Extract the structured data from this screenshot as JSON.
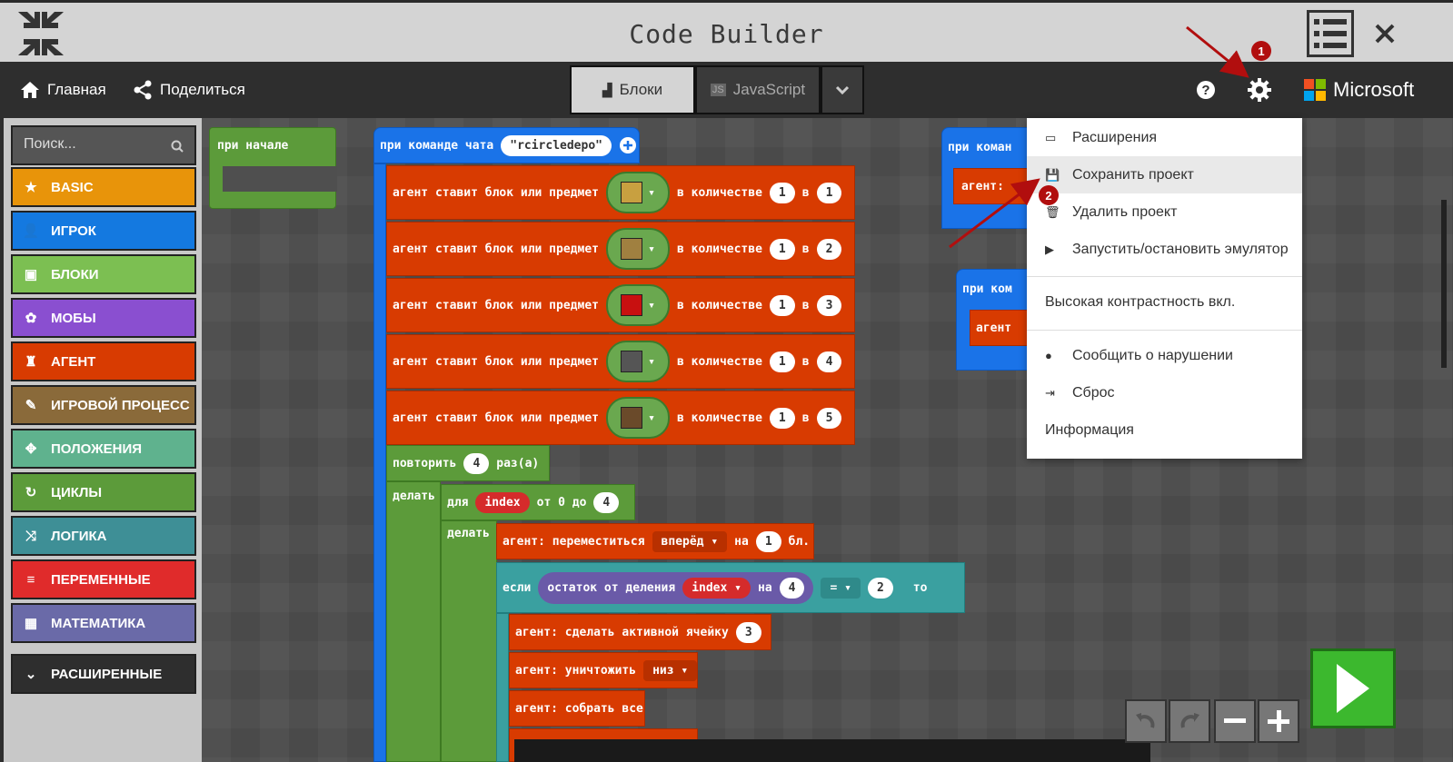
{
  "window": {
    "title": "Code Builder"
  },
  "nav": {
    "home_label": "Главная",
    "share_label": "Поделиться",
    "tab_blocks": "Блоки",
    "tab_js": "JavaScript",
    "brand": "Microsoft"
  },
  "sidebar": {
    "search_placeholder": "Поиск...",
    "categories": [
      {
        "label": "BASIC",
        "color": "#e8940a",
        "icon": "star-icon"
      },
      {
        "label": "ИГРОК",
        "color": "#1479e0",
        "icon": "person-icon"
      },
      {
        "label": "БЛОКИ",
        "color": "#7cbf52",
        "icon": "cube-icon"
      },
      {
        "label": "МОБЫ",
        "color": "#8a4fd0",
        "icon": "paw-icon"
      },
      {
        "label": "АГЕНТ",
        "color": "#d83b01",
        "icon": "agent-icon"
      },
      {
        "label": "ИГРОВОЙ ПРОЦЕСС",
        "color": "#8a6a3a",
        "icon": "wrench-icon"
      },
      {
        "label": "ПОЛОЖЕНИЯ",
        "color": "#5fb28e",
        "icon": "crosshair-icon"
      },
      {
        "label": "ЦИКЛЫ",
        "color": "#5c9b3a",
        "icon": "loop-icon"
      },
      {
        "label": "ЛОГИКА",
        "color": "#3e8f96",
        "icon": "shuffle-icon"
      },
      {
        "label": "ПЕРЕМЕННЫЕ",
        "color": "#e02b2b",
        "icon": "list-icon"
      },
      {
        "label": "МАТЕМАТИКА",
        "color": "#6a6aa8",
        "icon": "calculator-icon"
      },
      {
        "label": "РАСШИРЕННЫЕ",
        "color": "#2e2e2e",
        "icon": "chevron-down-icon"
      }
    ]
  },
  "workspace": {
    "on_start": "при начале",
    "on_chat": "при команде чата",
    "chat_command": "rcircledepo",
    "place_label": "агент ставит блок или предмет",
    "amount_label": "в количестве",
    "in_label": "в",
    "place_rows": [
      {
        "amount": "1",
        "slot": "1"
      },
      {
        "amount": "1",
        "slot": "2"
      },
      {
        "amount": "1",
        "slot": "3"
      },
      {
        "amount": "1",
        "slot": "4"
      },
      {
        "amount": "1",
        "slot": "5"
      }
    ],
    "repeat_label": "повторить",
    "repeat_count": "4",
    "repeat_times": "раз(а)",
    "do_label": "делать",
    "for_label": "для",
    "index_var": "index",
    "from_to": "от 0 до",
    "for_to": "4",
    "move_label": "агент: переместиться",
    "move_dir": "вперёд",
    "move_on": "на",
    "move_amount": "1",
    "move_unit": "бл.",
    "if_label": "если",
    "mod_label": "остаток от деления",
    "mod_on": "на",
    "mod_value": "4",
    "eq_op": "=",
    "eq_value": "2",
    "then_label": "то",
    "active_slot_label": "агент: сделать активной ячейку",
    "active_slot": "3",
    "destroy_label": "агент: уничтожить",
    "destroy_dir": "низ",
    "collect_label": "агент: собрать все",
    "partial_top": "при коман",
    "partial_agent": "агент:",
    "partial_top2": "при ком",
    "partial_agent2": "агент"
  },
  "menu": {
    "items": [
      {
        "label": "Расширения",
        "icon": "extensions-icon"
      },
      {
        "label": "Сохранить проект",
        "icon": "save-icon"
      },
      {
        "label": "Удалить проект",
        "icon": "trash-icon"
      },
      {
        "label": "Запустить/остановить эмулятор",
        "icon": "play-box-icon"
      },
      {
        "label": "Высокая контрастность вкл.",
        "icon": ""
      },
      {
        "label": "Сообщить о нарушении",
        "icon": "alert-icon"
      },
      {
        "label": "Сброс",
        "icon": "reset-icon"
      },
      {
        "label": "Информация",
        "icon": ""
      }
    ]
  },
  "annotations": {
    "badge1": "1",
    "badge2": "2"
  }
}
